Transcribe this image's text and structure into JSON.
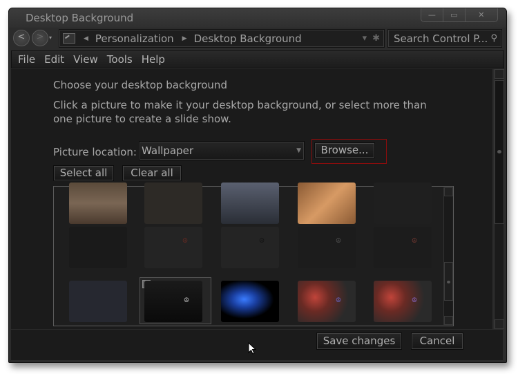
{
  "window": {
    "title": "Desktop Background",
    "caption_buttons": {
      "minimize": "—",
      "maximize": "▭",
      "close": "✕"
    }
  },
  "nav": {
    "back_glyph": "<",
    "forward_glyph": ">",
    "history_dropdown_glyph": "▾",
    "breadcrumb": [
      {
        "label": "Personalization"
      },
      {
        "label": "Desktop Background"
      }
    ],
    "address_dropdown_glyph": "▾",
    "refresh_glyph": "✱",
    "search_placeholder": "Search Control P...",
    "search_icon_glyph": "⚲"
  },
  "menu": [
    "File",
    "Edit",
    "View",
    "Tools",
    "Help"
  ],
  "main": {
    "heading": "Choose your desktop background",
    "description": "Click a picture to make it your desktop background, or select more than one picture to create a slide show.",
    "picture_location_label": "Picture location:",
    "picture_location_value": "Wallpaper",
    "browse_label": "Browse...",
    "select_all_label": "Select all",
    "clear_all_label": "Clear all"
  },
  "gallery": {
    "selected_count": 1,
    "thumbnails": [
      {
        "name": "brown-wood",
        "color": "#6e5a48",
        "selected": false
      },
      {
        "name": "dark-mesh",
        "color": "#2d2a26",
        "selected": false
      },
      {
        "name": "steel-gradient",
        "color": "#3f4450",
        "selected": false
      },
      {
        "name": "copper-check",
        "color": "#b07a4c",
        "selected": false
      },
      {
        "name": "dark-dots",
        "color": "#1f1f1f",
        "selected": false
      },
      {
        "name": "black-carbon",
        "color": "#1a1a1a",
        "selected": false
      },
      {
        "name": "dark-red-peace",
        "color": "#242424",
        "selected": false
      },
      {
        "name": "dark-black-peace",
        "color": "#242424",
        "selected": false
      },
      {
        "name": "black-grey-peace",
        "color": "#1c1c1c",
        "selected": false
      },
      {
        "name": "black-red-peace",
        "color": "#1c1c1c",
        "selected": false
      },
      {
        "name": "navy-texture",
        "color": "#262830",
        "selected": false
      },
      {
        "name": "black-silver-peace",
        "color": "#111111",
        "selected": true
      },
      {
        "name": "blue-mushrooms",
        "color": "#000000",
        "selected": false
      },
      {
        "name": "red-lava-peace-1",
        "color": "#6a2a24",
        "selected": false
      },
      {
        "name": "red-lava-peace-2",
        "color": "#6a2a24",
        "selected": false
      }
    ]
  },
  "footer": {
    "save_label": "Save changes",
    "cancel_label": "Cancel"
  }
}
